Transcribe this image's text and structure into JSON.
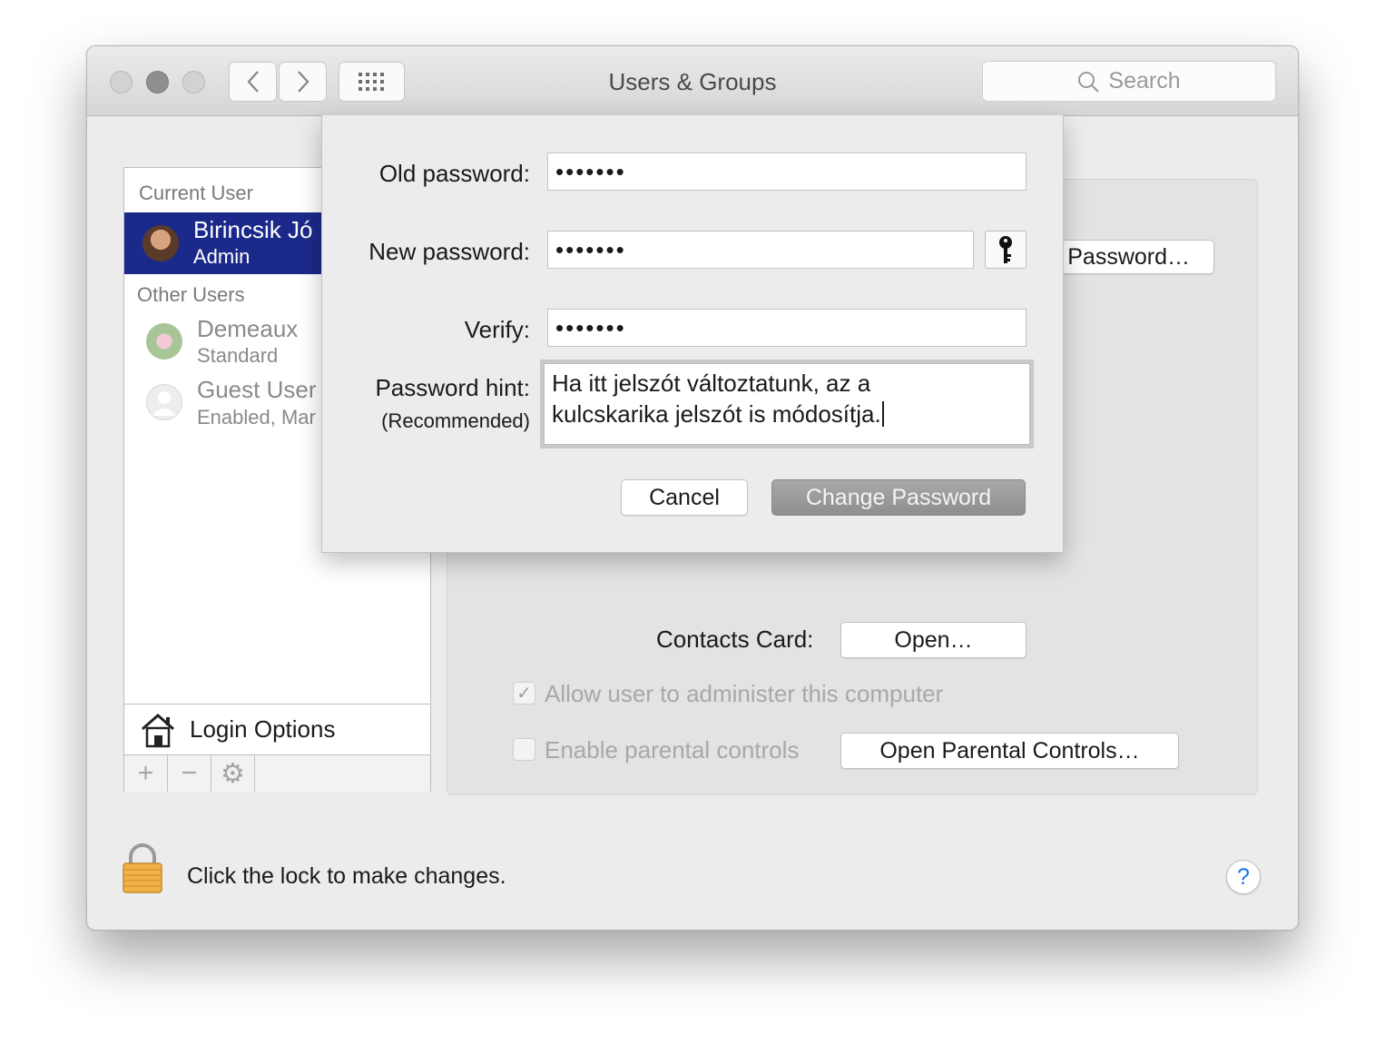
{
  "window": {
    "title": "Users & Groups",
    "search_placeholder": "Search"
  },
  "sidebar": {
    "current_user_label": "Current User",
    "current_user": {
      "name": "Birincsik Jó",
      "role": "Admin"
    },
    "other_users_label": "Other Users",
    "other_users": [
      {
        "name": "Demeaux",
        "role": "Standard"
      },
      {
        "name": "Guest User",
        "role": "Enabled, Mar"
      }
    ],
    "login_options_label": "Login Options",
    "tools": {
      "add": "+",
      "remove": "−",
      "action": "⚙"
    }
  },
  "panel": {
    "change_password_button": "Password…",
    "contacts_card_label": "Contacts Card:",
    "open_button": "Open…",
    "allow_admin_label": "Allow user to administer this computer",
    "allow_admin_checked": true,
    "parental_controls_label": "Enable parental controls",
    "parental_controls_checked": false,
    "open_parental_button": "Open Parental Controls…"
  },
  "dialog": {
    "old_password_label": "Old password:",
    "old_password_value": "•••••••",
    "new_password_label": "New password:",
    "new_password_value": "•••••••",
    "verify_label": "Verify:",
    "verify_value": "•••••••",
    "hint_label": "Password hint:",
    "hint_sublabel": "(Recommended)",
    "hint_line1": "Ha itt jelszót változtatunk, az a",
    "hint_line2": "kulcskarika jelszót is módosítja.",
    "cancel_button": "Cancel",
    "change_button": "Change Password"
  },
  "footer": {
    "lock_text": "Click the lock to make changes.",
    "help_label": "?"
  },
  "colors": {
    "selection": "#1b2a8a",
    "help_accent": "#1f74e6",
    "primary_button": "#9b9b9b"
  }
}
